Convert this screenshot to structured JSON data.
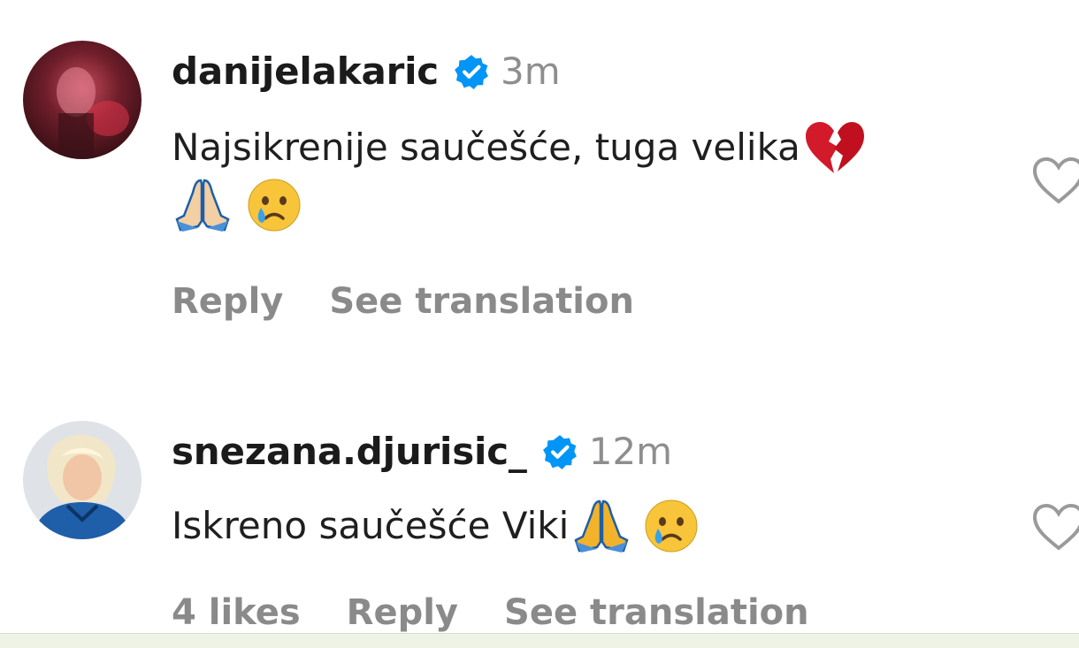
{
  "comments": [
    {
      "username": "danijelakaric",
      "verified": true,
      "time": "3m",
      "text_line1": "Najsikrenije saučešće, tuga velika",
      "text_line1_emoji": "broken-heart",
      "text_line2_emoji": [
        "folded-hands",
        "crying-face"
      ],
      "actions": {
        "reply": "Reply",
        "translate": "See translation"
      },
      "avatar_icon": "user-avatar-dark-red"
    },
    {
      "username": "snezana.djurisic_",
      "verified": true,
      "time": "12m",
      "text_line1": "Iskreno saučešće Viki",
      "text_line1_emoji": [
        "folded-hands",
        "crying-face"
      ],
      "actions": {
        "likes": "4 likes",
        "reply": "Reply",
        "translate": "See translation"
      },
      "avatar_icon": "user-avatar-blonde"
    }
  ],
  "colors": {
    "verified_blue": "#0095f6",
    "muted_gray": "#8e8e8e",
    "broken_heart_red": "#d21a2a"
  }
}
